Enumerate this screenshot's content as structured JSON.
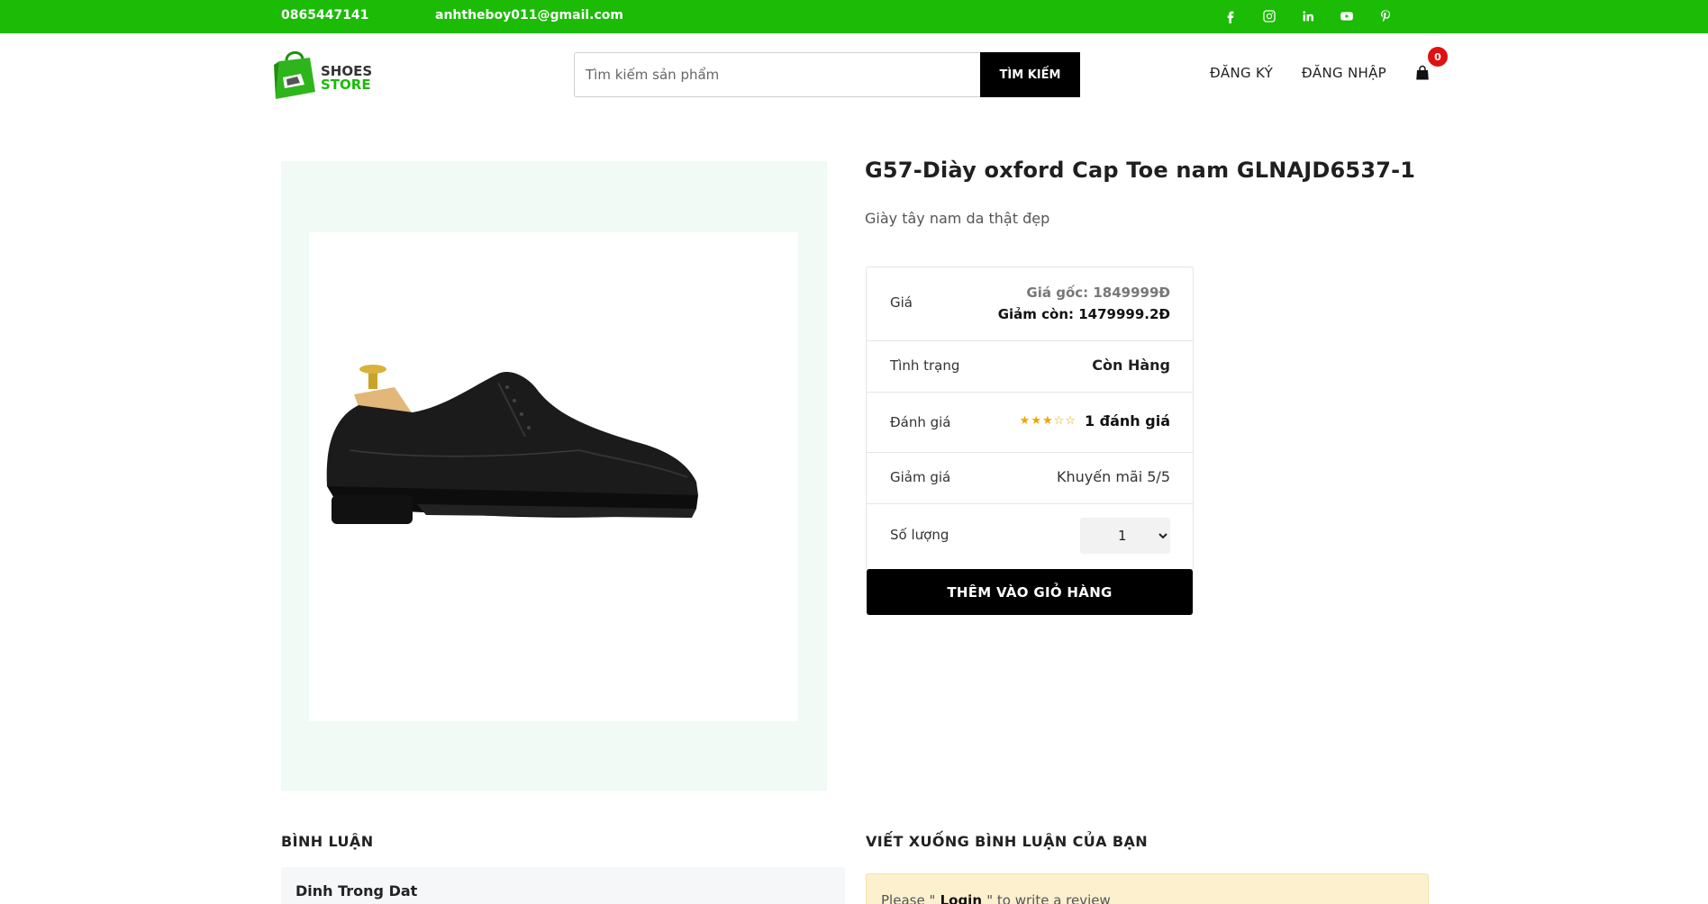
{
  "topbar": {
    "phone": "0865447141",
    "email": "anhtheboy011@gmail.com",
    "socials": [
      "facebook-icon",
      "instagram-icon",
      "linkedin-icon",
      "youtube-icon",
      "pinterest-icon"
    ],
    "bg_color": "#1bbb06"
  },
  "header": {
    "logo_line1": "SHOES",
    "logo_line2": "STORE",
    "search_placeholder": "Tìm kiếm sản phẩm",
    "search_button": "TÌM KIẾM",
    "register": "ĐĂNG KÝ",
    "login": "ĐĂNG NHẬP",
    "cart_count": "0"
  },
  "product": {
    "title": "G57-Diày oxford Cap Toe nam GLNAJD6537-1",
    "subtitle": "Giày tây nam da thật đẹp",
    "price_label": "Giá",
    "price_original": "Giá gốc: 1849999Đ",
    "price_discounted": "Giảm còn: 1479999.2Đ",
    "status_label": "Tình trạng",
    "status_value": "Còn Hàng",
    "rating_label": "Đánh giá",
    "rating_stars": 3,
    "rating_max": 5,
    "rating_text": "1 đánh giá",
    "discount_label": "Giảm giá",
    "discount_value": "Khuyến mãi 5/5",
    "quantity_label": "Số lượng",
    "quantity_value": "1",
    "add_to_cart": "THÊM VÀO GIỎ HÀNG"
  },
  "comments": {
    "title": "BÌNH LUẬN",
    "author": "Dinh Trong Dat"
  },
  "write_review": {
    "title": "VIẾT XUỐNG BÌNH LUẬN CỦA BẠN",
    "prefix": "Please \"",
    "login_link": " Login ",
    "suffix": "\" to write a review"
  }
}
